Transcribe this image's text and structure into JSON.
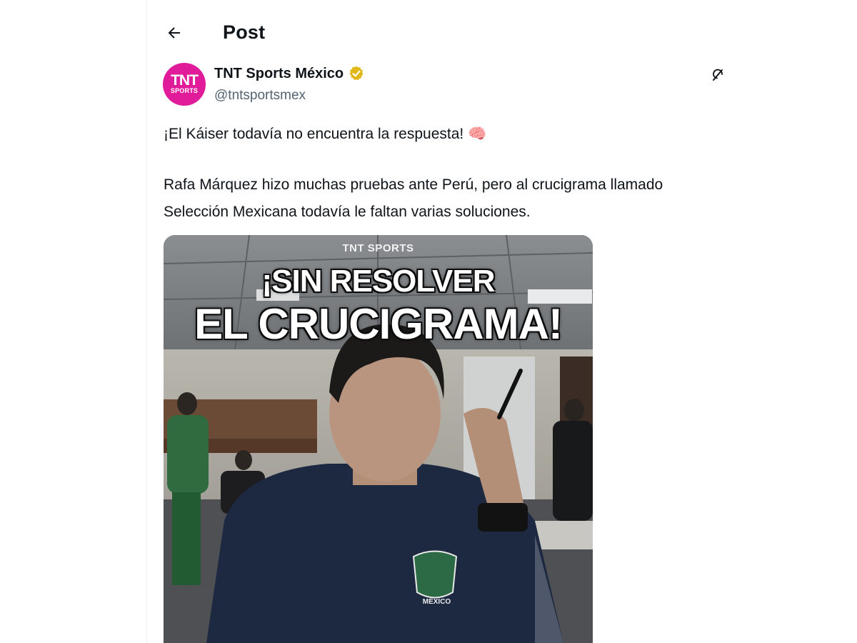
{
  "header": {
    "title": "Post",
    "back_icon": "arrow-left-icon"
  },
  "author": {
    "name": "TNT Sports México",
    "handle": "@tntsportsmex",
    "verified_icon": "verified-badge-icon",
    "verified_color": "#e2b719",
    "avatar_color": "#e11c9a",
    "avatar_big": "TNT",
    "avatar_small": "SPORTS"
  },
  "tweet": {
    "line1": "¡El Káiser todavía no encuentra la respuesta! 🧠",
    "line2": "Rafa Márquez hizo muchas pruebas ante Perú, pero al crucigrama llamado Selección Mexicana todavía le faltan varias soluciones."
  },
  "media": {
    "brand": "TNT SPORTS",
    "headline_1": "¡SIN RESOLVER",
    "headline_2": "EL CRUCIGRAMA!",
    "crest_label": "MÉXICO"
  },
  "icons": {
    "grok": "grok-icon"
  }
}
